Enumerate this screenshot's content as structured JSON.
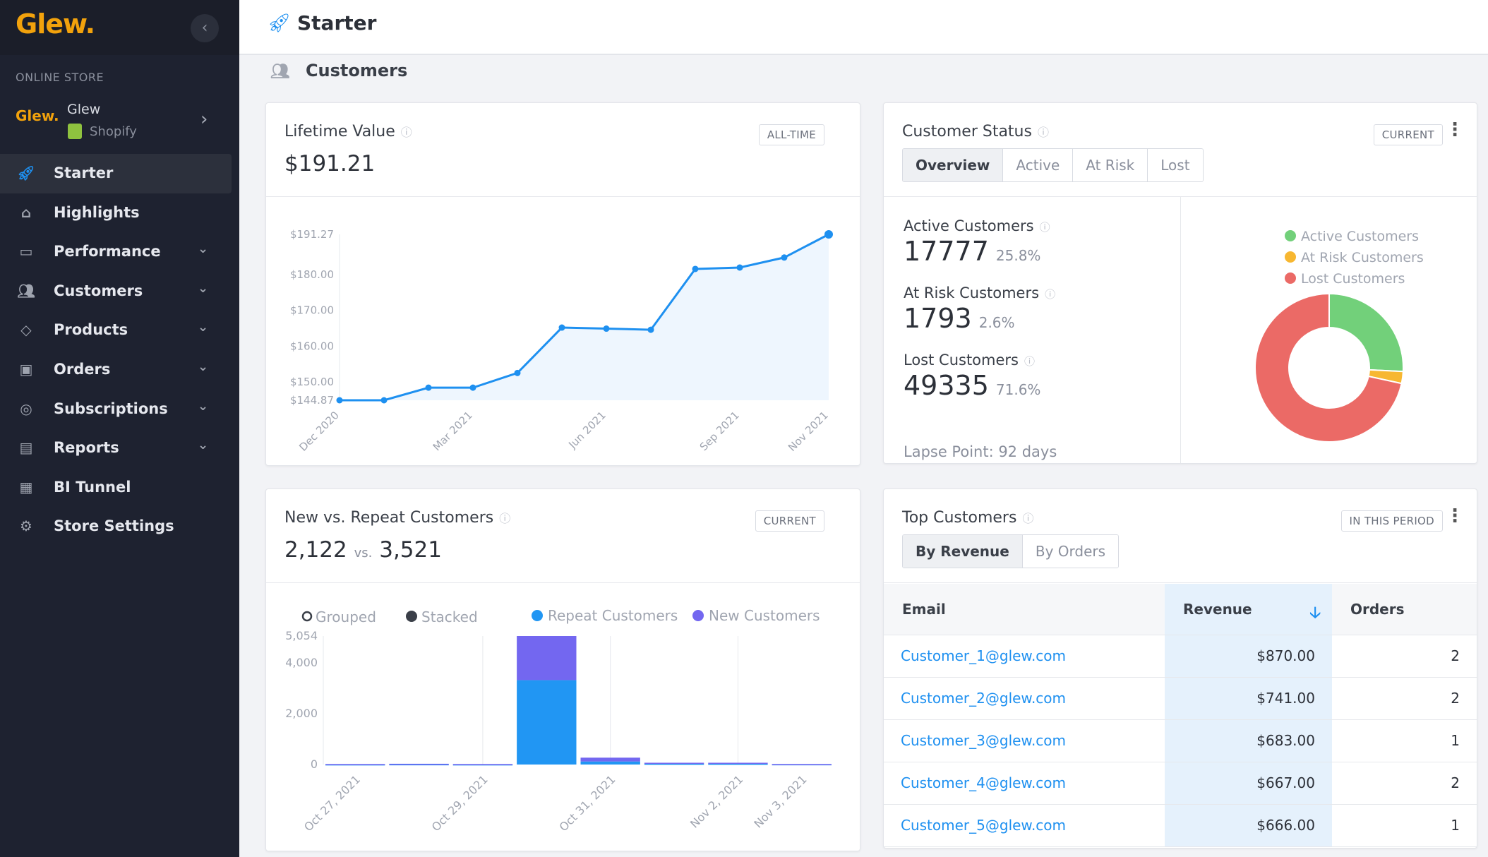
{
  "app": {
    "logo": "Glew.",
    "collapse_icon": "chevron-left-icon"
  },
  "sidebar": {
    "section_label": "ONLINE STORE",
    "store": {
      "logo": "Glew.",
      "name": "Glew",
      "platform": "Shopify"
    },
    "items": [
      {
        "label": "Starter",
        "icon": "rocket-icon",
        "active": true,
        "expandable": false
      },
      {
        "label": "Highlights",
        "icon": "home-icon",
        "expandable": false
      },
      {
        "label": "Performance",
        "icon": "monitor-icon",
        "expandable": true
      },
      {
        "label": "Customers",
        "icon": "users-icon",
        "expandable": true
      },
      {
        "label": "Products",
        "icon": "tag-icon",
        "expandable": true
      },
      {
        "label": "Orders",
        "icon": "inbox-icon",
        "expandable": true
      },
      {
        "label": "Subscriptions",
        "icon": "refresh-icon",
        "expandable": true
      },
      {
        "label": "Reports",
        "icon": "document-icon",
        "expandable": true
      },
      {
        "label": "BI Tunnel",
        "icon": "terminal-icon",
        "expandable": false
      },
      {
        "label": "Store Settings",
        "icon": "gear-icon",
        "expandable": false
      }
    ]
  },
  "header": {
    "title": "Starter",
    "section": "Customers"
  },
  "colors": {
    "accent": "#1e90f0",
    "brand": "#f2a20c",
    "active": "#72d07a",
    "at_risk": "#f7b731",
    "lost": "#eb6a66",
    "new": "#7367f0",
    "repeat": "#2196f3"
  },
  "lifetime_value": {
    "title": "Lifetime Value",
    "badge": "ALL-TIME",
    "value": "$191.21",
    "chart_data": {
      "type": "area",
      "x": [
        "Dec 2020",
        "Jan 2021",
        "Feb 2021",
        "Mar 2021",
        "Apr 2021",
        "May 2021",
        "Jun 2021",
        "Jul 2021",
        "Aug 2021",
        "Sep 2021",
        "Oct 2021",
        "Nov 2021"
      ],
      "values": [
        144.87,
        144.87,
        148.4,
        148.4,
        152.5,
        165.2,
        164.9,
        164.6,
        181.6,
        182.0,
        184.8,
        191.27
      ],
      "xticks": [
        "Dec 2020",
        "Mar 2021",
        "Jun 2021",
        "Sep 2021",
        "Nov 2021"
      ],
      "yticks": [
        "$144.87",
        "$150.00",
        "$160.00",
        "$170.00",
        "$180.00",
        "$191.27"
      ],
      "ylim": [
        144.87,
        191.27
      ]
    }
  },
  "customer_status": {
    "title": "Customer Status",
    "badge": "CURRENT",
    "tabs": [
      "Overview",
      "Active",
      "At Risk",
      "Lost"
    ],
    "selected_tab": "Overview",
    "metrics": [
      {
        "label": "Active Customers",
        "value": "17777",
        "pct": "25.8%"
      },
      {
        "label": "At Risk Customers",
        "value": "1793",
        "pct": "2.6%"
      },
      {
        "label": "Lost Customers",
        "value": "49335",
        "pct": "71.6%"
      }
    ],
    "lapse_point": "Lapse Point: 92 days",
    "chart_data": {
      "type": "pie",
      "legend": [
        "Active Customers",
        "At Risk Customers",
        "Lost Customers"
      ],
      "values": [
        25.8,
        2.6,
        71.6
      ]
    }
  },
  "new_vs_repeat": {
    "title": "New vs. Repeat Customers",
    "badge": "CURRENT",
    "new_value": "2,122",
    "vs": "vs.",
    "repeat_value": "3,521",
    "mode_options": [
      "Grouped",
      "Stacked"
    ],
    "selected_mode": "Stacked",
    "chart_data": {
      "type": "bar",
      "stacked": true,
      "categories": [
        "Oct 27, 2021",
        "Oct 28, 2021",
        "Oct 29, 2021",
        "Oct 30, 2021",
        "Oct 31, 2021",
        "Nov 1, 2021",
        "Nov 2, 2021",
        "Nov 3, 2021"
      ],
      "xticks": [
        "Oct 27, 2021",
        "Oct 29, 2021",
        "Oct 31, 2021",
        "Nov 2, 2021",
        "Nov 3, 2021"
      ],
      "series": [
        {
          "name": "Repeat Customers",
          "values": [
            5,
            10,
            5,
            3320,
            120,
            30,
            30,
            10
          ]
        },
        {
          "name": "New Customers",
          "values": [
            15,
            20,
            15,
            1734,
            150,
            40,
            40,
            10
          ]
        }
      ],
      "yticks": [
        "0",
        "2,000",
        "4,000",
        "5,054"
      ],
      "ylim": [
        0,
        5054
      ]
    }
  },
  "top_customers": {
    "title": "Top Customers",
    "badge": "IN THIS PERIOD",
    "tabs": [
      "By Revenue",
      "By Orders"
    ],
    "selected_tab": "By Revenue",
    "columns": [
      "Email",
      "Revenue",
      "Orders"
    ],
    "sort_icon": "arrow-down-icon",
    "rows": [
      {
        "email": "Customer_1@glew.com",
        "revenue": "$870.00",
        "orders": "2"
      },
      {
        "email": "Customer_2@glew.com",
        "revenue": "$741.00",
        "orders": "2"
      },
      {
        "email": "Customer_3@glew.com",
        "revenue": "$683.00",
        "orders": "1"
      },
      {
        "email": "Customer_4@glew.com",
        "revenue": "$667.00",
        "orders": "2"
      },
      {
        "email": "Customer_5@glew.com",
        "revenue": "$666.00",
        "orders": "1"
      }
    ]
  }
}
